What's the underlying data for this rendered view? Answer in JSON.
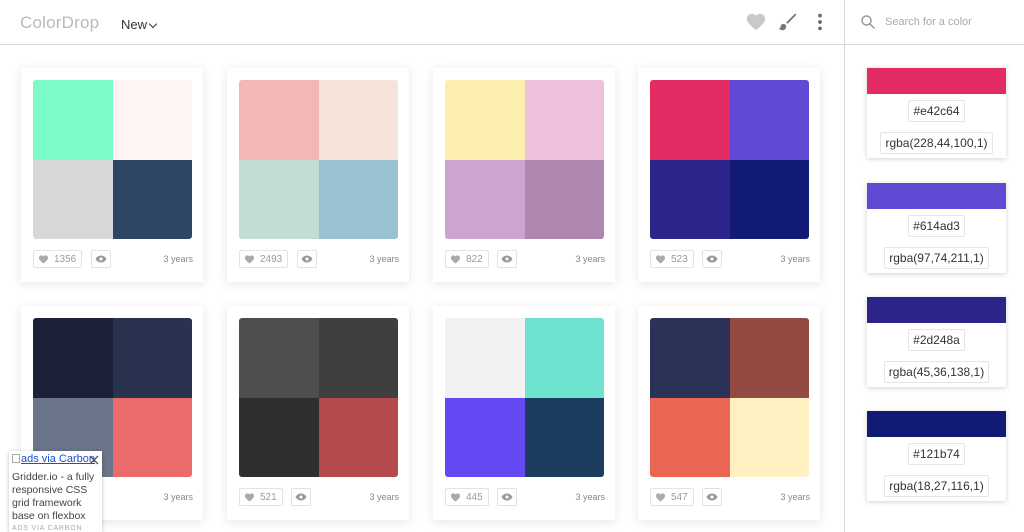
{
  "header": {
    "logo": "ColorDrop",
    "sort_label": "New",
    "icons": [
      "heart-icon",
      "paintbrush-icon",
      "more-vertical-icon"
    ]
  },
  "search": {
    "placeholder": "Search for a color",
    "value": ""
  },
  "selected_palette": {
    "swatches": [
      {
        "color": "#e42c64",
        "hex": "#e42c64",
        "rgba": "rgba(228,44,100,1)"
      },
      {
        "color": "#614ad3",
        "hex": "#614ad3",
        "rgba": "rgba(97,74,211,1)"
      },
      {
        "color": "#2d248a",
        "hex": "#2d248a",
        "rgba": "rgba(45,36,138,1)"
      },
      {
        "color": "#121b74",
        "hex": "#121b74",
        "rgba": "rgba(18,27,116,1)"
      }
    ]
  },
  "palettes": [
    {
      "colors": [
        "#7bfbc6",
        "#fff5f5",
        "#d8d8d8",
        "#2c4663"
      ],
      "likes": "1356",
      "age": "3 years"
    },
    {
      "colors": [
        "#f2b8b8",
        "#f6e3d9",
        "#c3ddd6",
        "#98c2d0"
      ],
      "likes": "2493",
      "age": "3 years"
    },
    {
      "colors": [
        "#fcefae",
        "#efc0dc",
        "#cda3cf",
        "#ae87ae"
      ],
      "likes": "822",
      "age": "3 years"
    },
    {
      "colors": [
        "#e42c64",
        "#614ad3",
        "#2d248a",
        "#121b74"
      ],
      "likes": "523",
      "age": "3 years"
    },
    {
      "colors": [
        "#1b2238",
        "#29334f",
        "#6b7589",
        "#eb6a6a"
      ],
      "likes": "",
      "age": "3 years"
    },
    {
      "colors": [
        "#4e4e4e",
        "#3f3f3f",
        "#2f2f2f",
        "#b54a4a"
      ],
      "likes": "521",
      "age": "3 years"
    },
    {
      "colors": [
        "#f2f2f2",
        "#6de3d0",
        "#6449f2",
        "#1d3d60"
      ],
      "likes": "445",
      "age": "3 years"
    },
    {
      "colors": [
        "#2b3258",
        "#944a42",
        "#e96655",
        "#fff0c2"
      ],
      "likes": "547",
      "age": "3 years"
    }
  ],
  "ad": {
    "image_alt": "ads via Carbon",
    "text": "Gridder.io - a fully responsive CSS grid framework base on flexbox",
    "via": "ADS VIA CARBON"
  }
}
